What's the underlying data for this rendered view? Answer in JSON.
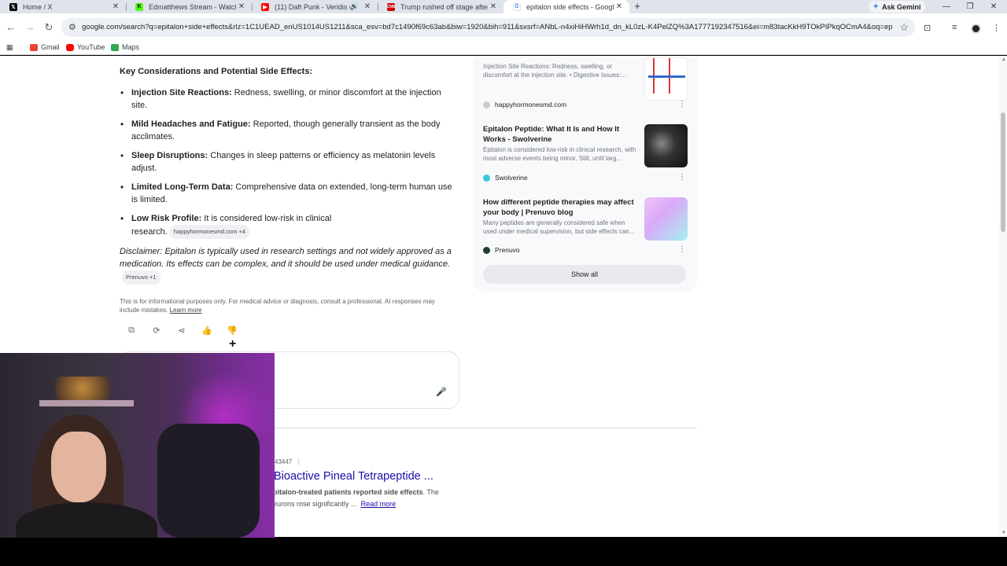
{
  "tabs": [
    {
      "title": "Home / X",
      "icon": "x-logo-icon",
      "color": "#000000"
    },
    {
      "title": "Edmatthews Stream - Watch Li",
      "icon": "kick-logo-icon",
      "color": "#53fc18"
    },
    {
      "title": "(11) Daft Punk - Veridis Qu",
      "icon": "youtube-icon",
      "color": "#ff0000"
    },
    {
      "title": "Trump rushed off stage after sh",
      "icon": "cnn-icon",
      "color": "#cc0000"
    },
    {
      "title": "epitalon side effects - Google S",
      "icon": "google-icon",
      "color": "#4285f4",
      "active": true
    }
  ],
  "new_tab": "+",
  "ask_gemini": "Ask Gemini",
  "url": "google.com/search?q=epitalon+side+effects&rlz=1C1UEAD_enUS1014US1211&sca_esv=bd7c1490f69c63ab&biw=1920&bih=911&sxsrf=ANbL-n4xiHiHWrh1d_dn_kL0zL-K4PelZQ%3A1777192347516&ei=m83tacKkH9TOkPIPkqOCmA4&oq=epitalo...",
  "bookmarks": [
    {
      "label": "Gmail",
      "color": "#ea4335"
    },
    {
      "label": "YouTube",
      "color": "#ff0000"
    },
    {
      "label": "Maps",
      "color": "#34a853"
    }
  ],
  "overview": {
    "heading": "Key Considerations and Potential Side Effects:",
    "items": [
      {
        "term": "Injection Site Reactions:",
        "text": " Redness, swelling, or minor discomfort at the injection site."
      },
      {
        "term": "Mild Headaches and Fatigue:",
        "text": " Reported, though generally transient as the body acclimates."
      },
      {
        "term": "Sleep Disruptions:",
        "text": " Changes in sleep patterns or efficiency as melatonin levels adjust."
      },
      {
        "term": "Limited Long-Term Data:",
        "text": " Comprehensive data on extended, long-term human use is limited."
      },
      {
        "term": "Low Risk Profile:",
        "text": " It is considered low-risk in clinical research.",
        "chip": "happyhormonesmd.com +4"
      }
    ],
    "disclaimer": "Disclaimer: Epitalon is typically used in research settings and not widely approved as a medication. Its effects can be complex, and it should be used under medical guidance.",
    "disclaimer_chip": "Prenuvo +1",
    "info": "This is for informational purposes only. For medical advice or diagnosis, consult a professional. AI responses may include mistakes.",
    "learn_more": "Learn more"
  },
  "sources": [
    {
      "title": "",
      "snippet": "Injection Site Reactions: Redness, swelling, or discomfort at the injection site. • Digestive Issues:...",
      "site": "happyhormonesmd.com",
      "site_color": "#cccccc"
    },
    {
      "title": "Epitalon Peptide: What It Is and How It Works - Swolverine",
      "snippet": "Epitalon is considered low-risk in clinical research, with most adverse events being minor. Still, until larg...",
      "site": "Swolverine",
      "site_color": "#38c6d9"
    },
    {
      "title": "How different peptide therapies may affect your body | Prenuvo blog",
      "snippet": "Many peptides are generally considered safe when used under medical supervision, but side effects can...",
      "site": "Prenuvo",
      "site_color": "#1f3d2e"
    }
  ],
  "show_all": "Show all",
  "result": {
    "meta": "43447",
    "title": "Bioactive Pineal Tetrapeptide ...",
    "snippet_bold": "pitalon-treated patients reported side effects",
    "snippet_rest": ". The",
    "snippet_line2": "eurons rose significantly ...",
    "read_more": "Read more"
  }
}
